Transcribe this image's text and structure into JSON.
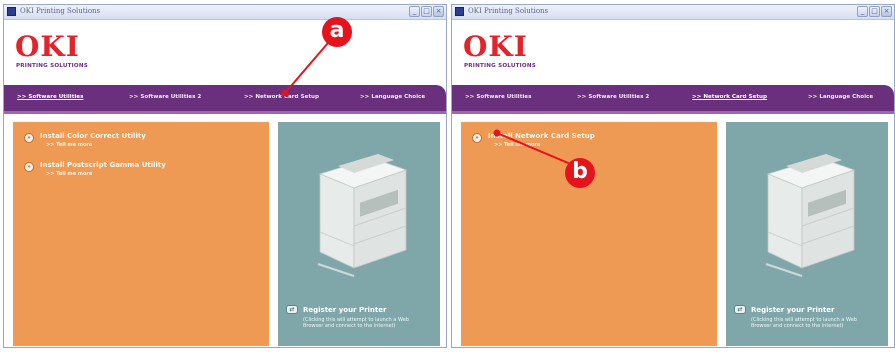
{
  "window": {
    "title": "OKI Printing Solutions",
    "minimize_glyph": "_",
    "maximize_glyph": "□",
    "close_glyph": "×"
  },
  "brand": {
    "logo": "OKI",
    "tagline": "PRINTING SOLUTIONS",
    "logo_color": "#e8202a",
    "nav_color": "#6a2f7d",
    "panel_orange": "#ee9a55",
    "panel_teal": "#7fa7aa"
  },
  "nav": {
    "items": [
      {
        "label": ">> Software Utilities"
      },
      {
        "label": ">> Software Utilities 2"
      },
      {
        "label": ">> Network Card Setup"
      },
      {
        "label": ">> Language Choice"
      }
    ]
  },
  "left_screen": {
    "active_nav": 0,
    "utilities": [
      {
        "label": "Install Color Correct Utility",
        "more": ">> Tell me more"
      },
      {
        "label": "Install Postscript Gamma Utility",
        "more": ">> Tell me more"
      }
    ],
    "callout": "a"
  },
  "right_screen": {
    "active_nav": 2,
    "utilities": [
      {
        "label": "Install Network Card Setup",
        "more": ">> Tell me more"
      }
    ],
    "callout": "b"
  },
  "register": {
    "title": "Register your Printer",
    "note_line1": "(Clicking this will attempt to launch a Web",
    "note_line2": "Browser and connect to the internet)",
    "icon_glyph": "⇄"
  },
  "callout_color": "#e4131c",
  "bullet_glyph": "»"
}
